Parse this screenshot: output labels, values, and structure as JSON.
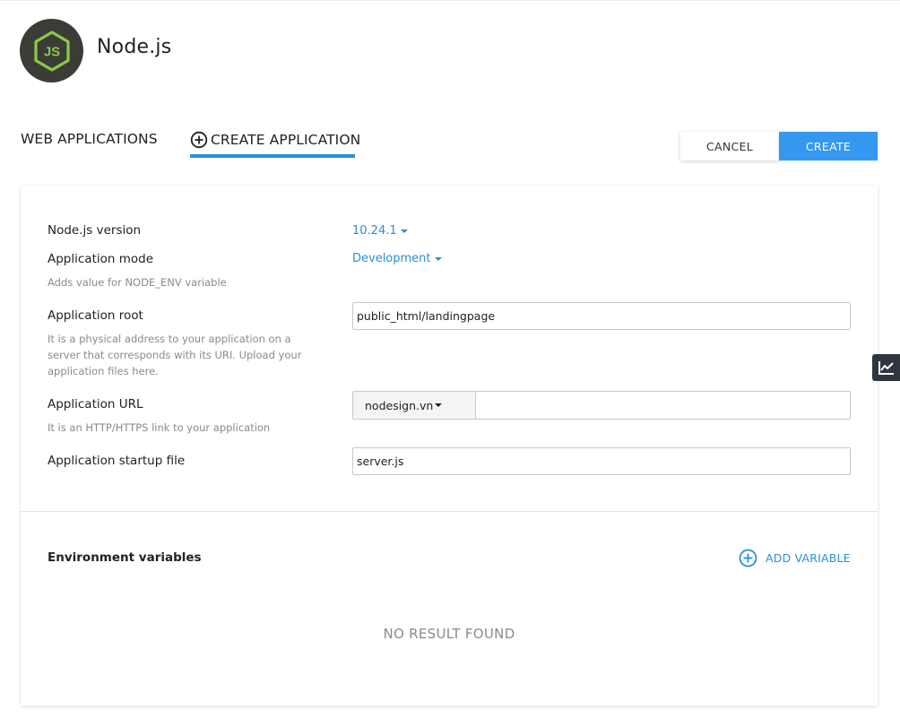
{
  "header": {
    "title": "Node.js",
    "logo_icon": "nodejs-logo-icon",
    "logo_text": "JS"
  },
  "tabs": [
    {
      "label": "WEB APPLICATIONS",
      "active": false
    },
    {
      "label": "CREATE APPLICATION",
      "active": true,
      "icon": "plus-circle-icon"
    }
  ],
  "actions": {
    "cancel_label": "CANCEL",
    "create_label": "CREATE"
  },
  "form": {
    "node_version": {
      "label": "Node.js version",
      "value": "10.24.1"
    },
    "app_mode": {
      "label": "Application mode",
      "value": "Development",
      "hint": "Adds value for NODE_ENV variable"
    },
    "app_root": {
      "label": "Application root",
      "value": "public_html/landingpage",
      "hint": "It is a physical address to your application on a server that corresponds with its URI. Upload your application files here."
    },
    "app_url": {
      "label": "Application URL",
      "domain": "nodesign.vn",
      "path": "",
      "hint": "It is an HTTP/HTTPS link to your application"
    },
    "startup_file": {
      "label": "Application startup file",
      "value": "server.js"
    }
  },
  "env": {
    "title": "Environment variables",
    "add_label": "ADD VARIABLE",
    "add_icon": "plus-circle-icon",
    "empty_text": "NO RESULT FOUND"
  },
  "side_widget": {
    "icon": "trend-chart-icon"
  },
  "colors": {
    "accent": "#2a8fd6",
    "primary_button": "#3498f0",
    "logo_bg": "#3c3c37",
    "logo_green": "#8cc84b"
  }
}
